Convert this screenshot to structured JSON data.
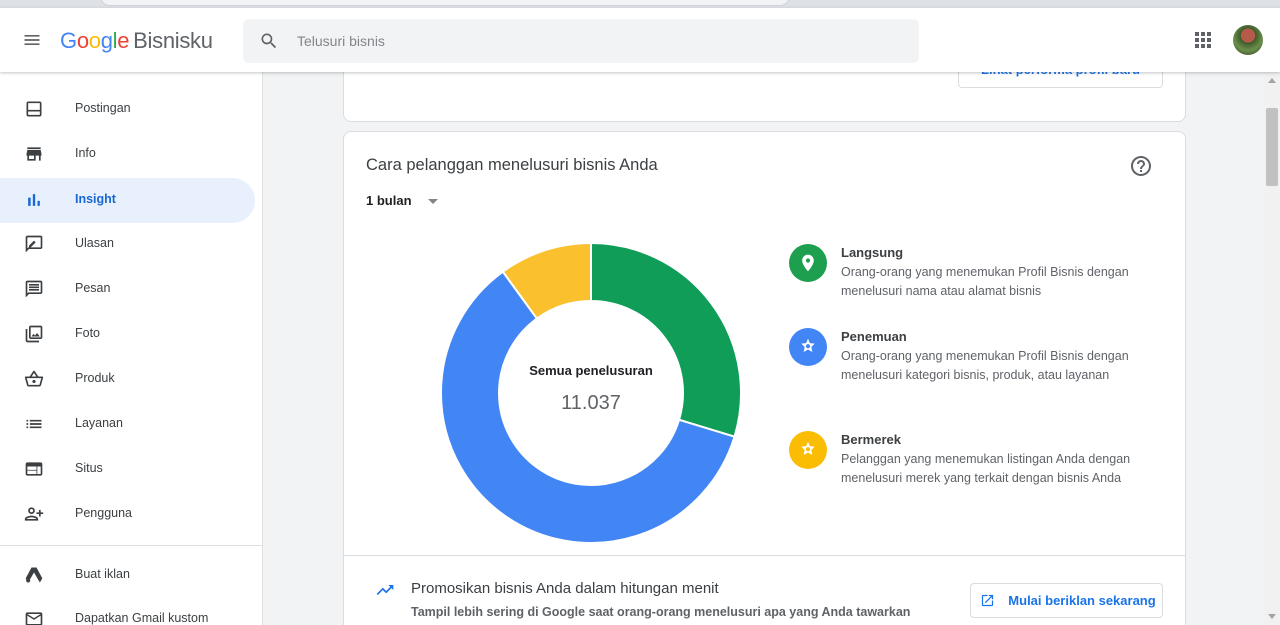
{
  "header": {
    "brand_google": [
      "G",
      "o",
      "o",
      "g",
      "l",
      "e"
    ],
    "brand_product": "Bisnisku",
    "search_placeholder": "Telusuri bisnis"
  },
  "sidebar": {
    "items": [
      {
        "label": "Postingan",
        "icon": "posts-icon"
      },
      {
        "label": "Info",
        "icon": "storefront-icon"
      },
      {
        "label": "Insight",
        "icon": "bar-chart-icon",
        "active": true
      },
      {
        "label": "Ulasan",
        "icon": "review-icon"
      },
      {
        "label": "Pesan",
        "icon": "message-icon"
      },
      {
        "label": "Foto",
        "icon": "photo-icon"
      },
      {
        "label": "Produk",
        "icon": "basket-icon"
      },
      {
        "label": "Layanan",
        "icon": "list-icon"
      },
      {
        "label": "Situs",
        "icon": "website-icon"
      },
      {
        "label": "Pengguna",
        "icon": "add-user-icon"
      },
      {
        "label": "Buat iklan",
        "icon": "google-ads-icon"
      },
      {
        "label": "Dapatkan Gmail kustom",
        "icon": "gmail-icon"
      }
    ]
  },
  "top_card": {
    "button_label": "Lihat performa profil baru"
  },
  "insight_card": {
    "title": "Cara pelanggan menelusuri bisnis Anda",
    "period": "1 bulan",
    "center_label": "Semua penelusuran",
    "center_value": "11.037",
    "legend": [
      {
        "name": "Langsung",
        "desc": "Orang-orang yang menemukan Profil Bisnis dengan menelusuri nama atau alamat bisnis",
        "color": "#0f9d58",
        "icon": "location-pin-icon"
      },
      {
        "name": "Penemuan",
        "desc": "Orang-orang yang menemukan Profil Bisnis dengan menelusuri kategori bisnis, produk, atau layanan",
        "color": "#4285f4",
        "icon": "discovery-icon"
      },
      {
        "name": "Bermerek",
        "desc": "Pelanggan yang menemukan listingan Anda dengan menelusuri merek yang terkait dengan bisnis Anda",
        "color": "#fbbc04",
        "icon": "branded-icon"
      }
    ]
  },
  "promo": {
    "title": "Promosikan bisnis Anda dalam hitungan menit",
    "subtitle": "Tampil lebih sering di Google saat orang-orang menelusuri apa yang Anda tawarkan",
    "button_label": "Mulai beriklan sekarang"
  },
  "chart_data": {
    "type": "pie",
    "categories": [
      "Langsung",
      "Penemuan",
      "Bermerek"
    ],
    "values": [
      0.297,
      0.603,
      0.1
    ],
    "colors": [
      "#0f9d58",
      "#4285f4",
      "#fbc02d"
    ],
    "total_label": "11.037"
  }
}
